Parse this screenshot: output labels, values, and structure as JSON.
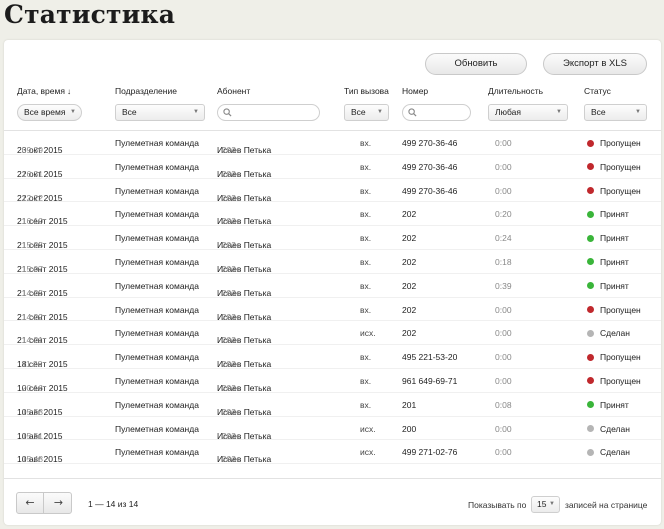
{
  "page_title": "Статистика",
  "toolbar": {
    "refresh_label": "Обновить",
    "export_label": "Экспорт в XLS"
  },
  "columns": {
    "date": "Дата, время",
    "dept": "Подразделение",
    "subscriber": "Абонент",
    "call_type": "Тип вызова",
    "number": "Номер",
    "duration": "Длительность",
    "status": "Статус"
  },
  "filters": {
    "date": "Все время",
    "dept": "Все",
    "subscriber": "",
    "call_type": "Все",
    "number": "",
    "duration": "Любая",
    "status": "Все"
  },
  "status_colors": {
    "missed": "#c0282d",
    "accepted": "#3ab53a",
    "made": "#b5b5b5"
  },
  "rows": [
    {
      "date": "23 окт 2015",
      "time": "09:39",
      "dept": "Пулеметная команда",
      "name": "Исаев Петька",
      "ext": "203",
      "type": "вх.",
      "number": "499 270-36-46",
      "duration": "0:00",
      "status": "Пропущен",
      "status_kind": "missed"
    },
    {
      "date": "22 окт 2015",
      "time": "16:31",
      "dept": "Пулеметная команда",
      "name": "Исаев Петька",
      "ext": "203",
      "type": "вх.",
      "number": "499 270-36-46",
      "duration": "0:00",
      "status": "Пропущен",
      "status_kind": "missed"
    },
    {
      "date": "22 окт 2015",
      "time": "12:22",
      "dept": "Пулеметная команда",
      "name": "Исаев Петька",
      "ext": "203",
      "type": "вх.",
      "number": "499 270-36-46",
      "duration": "0:00",
      "status": "Пропущен",
      "status_kind": "missed"
    },
    {
      "date": "21 сент 2015",
      "time": "16:10",
      "dept": "Пулеметная команда",
      "name": "Исаев Петька",
      "ext": "203",
      "type": "вх.",
      "number": "202",
      "duration": "0:20",
      "status": "Принят",
      "status_kind": "accepted"
    },
    {
      "date": "21 сент 2015",
      "time": "15:25",
      "dept": "Пулеметная команда",
      "name": "Исаев Петька",
      "ext": "203",
      "type": "вх.",
      "number": "202",
      "duration": "0:24",
      "status": "Принят",
      "status_kind": "accepted"
    },
    {
      "date": "21 сент 2015",
      "time": "15:07",
      "dept": "Пулеметная команда",
      "name": "Исаев Петька",
      "ext": "203",
      "type": "вх.",
      "number": "202",
      "duration": "0:18",
      "status": "Принят",
      "status_kind": "accepted"
    },
    {
      "date": "21 сент 2015",
      "time": "14:25",
      "dept": "Пулеметная команда",
      "name": "Исаев Петька",
      "ext": "203",
      "type": "вх.",
      "number": "202",
      "duration": "0:39",
      "status": "Принят",
      "status_kind": "accepted"
    },
    {
      "date": "21 сент 2015",
      "time": "14:22",
      "dept": "Пулеметная команда",
      "name": "Исаев Петька",
      "ext": "203",
      "type": "вх.",
      "number": "202",
      "duration": "0:00",
      "status": "Пропущен",
      "status_kind": "missed"
    },
    {
      "date": "21 сент 2015",
      "time": "14:21",
      "dept": "Пулеметная команда",
      "name": "Исаев Петька",
      "ext": "203",
      "type": "исх.",
      "number": "202",
      "duration": "0:00",
      "status": "Сделан",
      "status_kind": "made"
    },
    {
      "date": "18 сент 2015",
      "time": "11:28",
      "dept": "Пулеметная команда",
      "name": "Исаев Петька",
      "ext": "203",
      "type": "вх.",
      "number": "495 221-53-20",
      "duration": "0:00",
      "status": "Пропущен",
      "status_kind": "missed"
    },
    {
      "date": "10 сент 2015",
      "time": "20:16",
      "dept": "Пулеметная команда",
      "name": "Исаев Петька",
      "ext": "203",
      "type": "вх.",
      "number": "961 649-69-71",
      "duration": "0:00",
      "status": "Пропущен",
      "status_kind": "missed"
    },
    {
      "date": "10 авг 2015",
      "time": "15:53",
      "dept": "Пулеметная команда",
      "name": "Исаев Петька",
      "ext": "203",
      "type": "вх.",
      "number": "201",
      "duration": "0:08",
      "status": "Принят",
      "status_kind": "accepted"
    },
    {
      "date": "10 авг 2015",
      "time": "15:51",
      "dept": "Пулеметная команда",
      "name": "Исаев Петька",
      "ext": "203",
      "type": "исх.",
      "number": "200",
      "duration": "0:00",
      "status": "Сделан",
      "status_kind": "made"
    },
    {
      "date": "10 авг 2015",
      "time": "15:48",
      "dept": "Пулеметная команда",
      "name": "Исаев Петька",
      "ext": "203",
      "type": "исх.",
      "number": "499 271-02-76",
      "duration": "0:00",
      "status": "Сделан",
      "status_kind": "made"
    }
  ],
  "footer": {
    "prev_icon": "←",
    "next_icon": "→",
    "range": "1 — 14 из 14",
    "per_page_label": "Показывать по",
    "per_page_value": "15",
    "per_page_suffix": "записей на странице"
  }
}
